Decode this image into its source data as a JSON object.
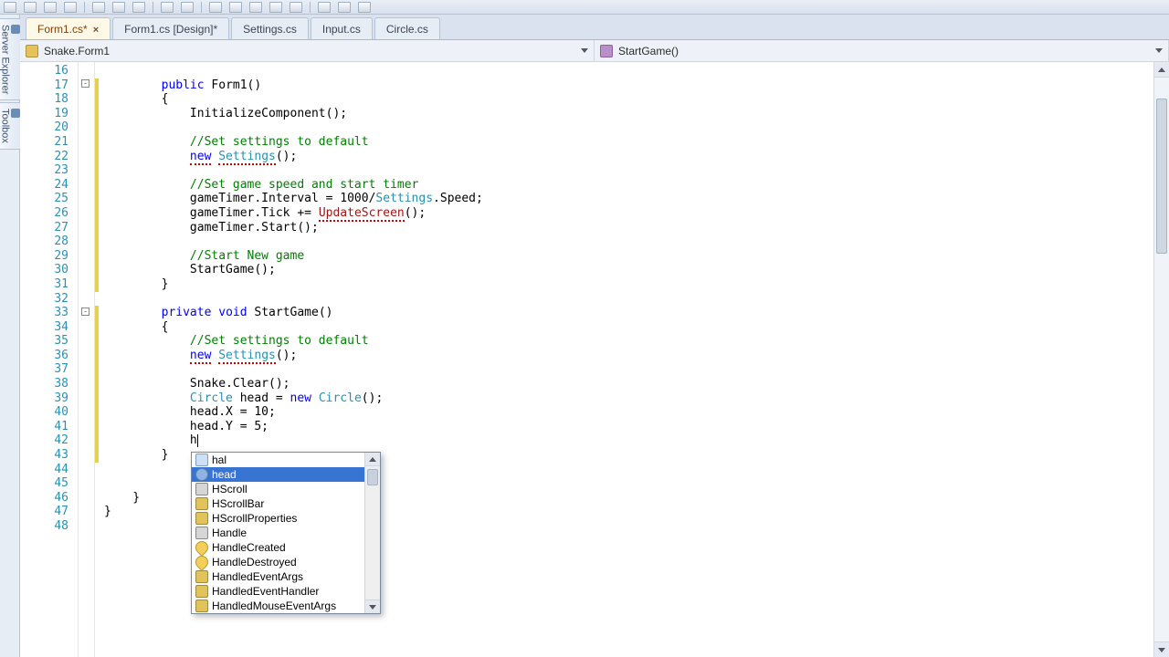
{
  "sidepanels": {
    "server_explorer": "Server Explorer",
    "toolbox": "Toolbox"
  },
  "tabs": [
    {
      "label": "Form1.cs*",
      "active": true,
      "closeable": true
    },
    {
      "label": "Form1.cs [Design]*",
      "active": false
    },
    {
      "label": "Settings.cs",
      "active": false
    },
    {
      "label": "Input.cs",
      "active": false
    },
    {
      "label": "Circle.cs",
      "active": false
    }
  ],
  "navbar": {
    "type": "Snake.Form1",
    "member": "StartGame()"
  },
  "lines": {
    "start": 16,
    "end": 48
  },
  "intellisense": {
    "filter": "hal",
    "selected_index": 1,
    "items": [
      {
        "label": "hal",
        "kind": "filter-echo"
      },
      {
        "label": "head",
        "kind": "fld"
      },
      {
        "label": "HScroll",
        "kind": "prp"
      },
      {
        "label": "HScrollBar",
        "kind": "cls"
      },
      {
        "label": "HScrollProperties",
        "kind": "cls"
      },
      {
        "label": "Handle",
        "kind": "prp"
      },
      {
        "label": "HandleCreated",
        "kind": "evt"
      },
      {
        "label": "HandleDestroyed",
        "kind": "evt"
      },
      {
        "label": "HandledEventArgs",
        "kind": "cls"
      },
      {
        "label": "HandledEventHandler",
        "kind": "cls"
      },
      {
        "label": "HandledMouseEventArgs",
        "kind": "cls"
      }
    ]
  },
  "code": {
    "l17": {
      "kw": "public",
      "name": "Form1()"
    },
    "l18": "        {",
    "l19": "            InitializeComponent();",
    "l21c": "            //Set settings to default",
    "l22": {
      "kw": "new",
      "typ": "Settings",
      "post": "();"
    },
    "l24c": "            //Set game speed and start timer",
    "l25a": "            gameTimer.Interval = 1000/",
    "l25b": "Settings",
    "l25c": ".Speed;",
    "l26a": "            gameTimer.Tick += ",
    "l26b": "UpdateScreen",
    "l26c": "();",
    "l27": "            gameTimer.Start();",
    "l29c": "            //Start New game",
    "l30": "            StartGame();",
    "l31": "        }",
    "l33": {
      "kw1": "private",
      "kw2": "void",
      "name": "StartGame()"
    },
    "l34": "        {",
    "l35c": "            //Set settings to default",
    "l36": {
      "kw": "new",
      "typ": "Settings",
      "post": "();"
    },
    "l38": "            Snake.Clear();",
    "l39a": "            ",
    "l39b": "Circle",
    "l39c": " head = ",
    "l39kw": "new",
    "l39d": " ",
    "l39e": "Circle",
    "l39f": "();",
    "l40": "            head.X = 10;",
    "l41": "            head.Y = 5;",
    "l42": "            h",
    "l43": "        }",
    "l46": "    }",
    "l47": "}"
  }
}
